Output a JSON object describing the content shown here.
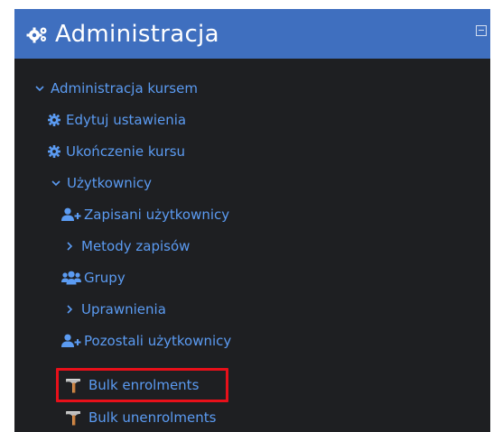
{
  "block": {
    "title": "Administracja",
    "icon": "cogs-icon",
    "collapse_icon": "collapse-box-icon"
  },
  "tree": {
    "root_label": "Administracja kursem",
    "items": [
      {
        "label": "Edytuj ustawienia",
        "icon": "gear-icon"
      },
      {
        "label": "Ukończenie kursu",
        "icon": "gear-icon"
      },
      {
        "label": "Użytkownicy",
        "icon": "chevron-down-icon"
      },
      {
        "label": "Zapisani użytkownicy",
        "icon": "user-plus-icon"
      },
      {
        "label": "Metody zapisów",
        "icon": "chevron-right-icon"
      },
      {
        "label": "Grupy",
        "icon": "users-icon"
      },
      {
        "label": "Uprawnienia",
        "icon": "chevron-right-icon"
      },
      {
        "label": "Pozostali użytkownicy",
        "icon": "user-plus-icon"
      },
      {
        "label": "Bulk enrolments",
        "icon": "hammer-icon"
      },
      {
        "label": "Bulk unenrolments",
        "icon": "hammer-icon"
      }
    ]
  },
  "colors": {
    "panel_bg": "#1e1f22",
    "header_bg": "#3f6fbf",
    "link": "#5b9bf2",
    "highlight_border": "#e8101a"
  }
}
